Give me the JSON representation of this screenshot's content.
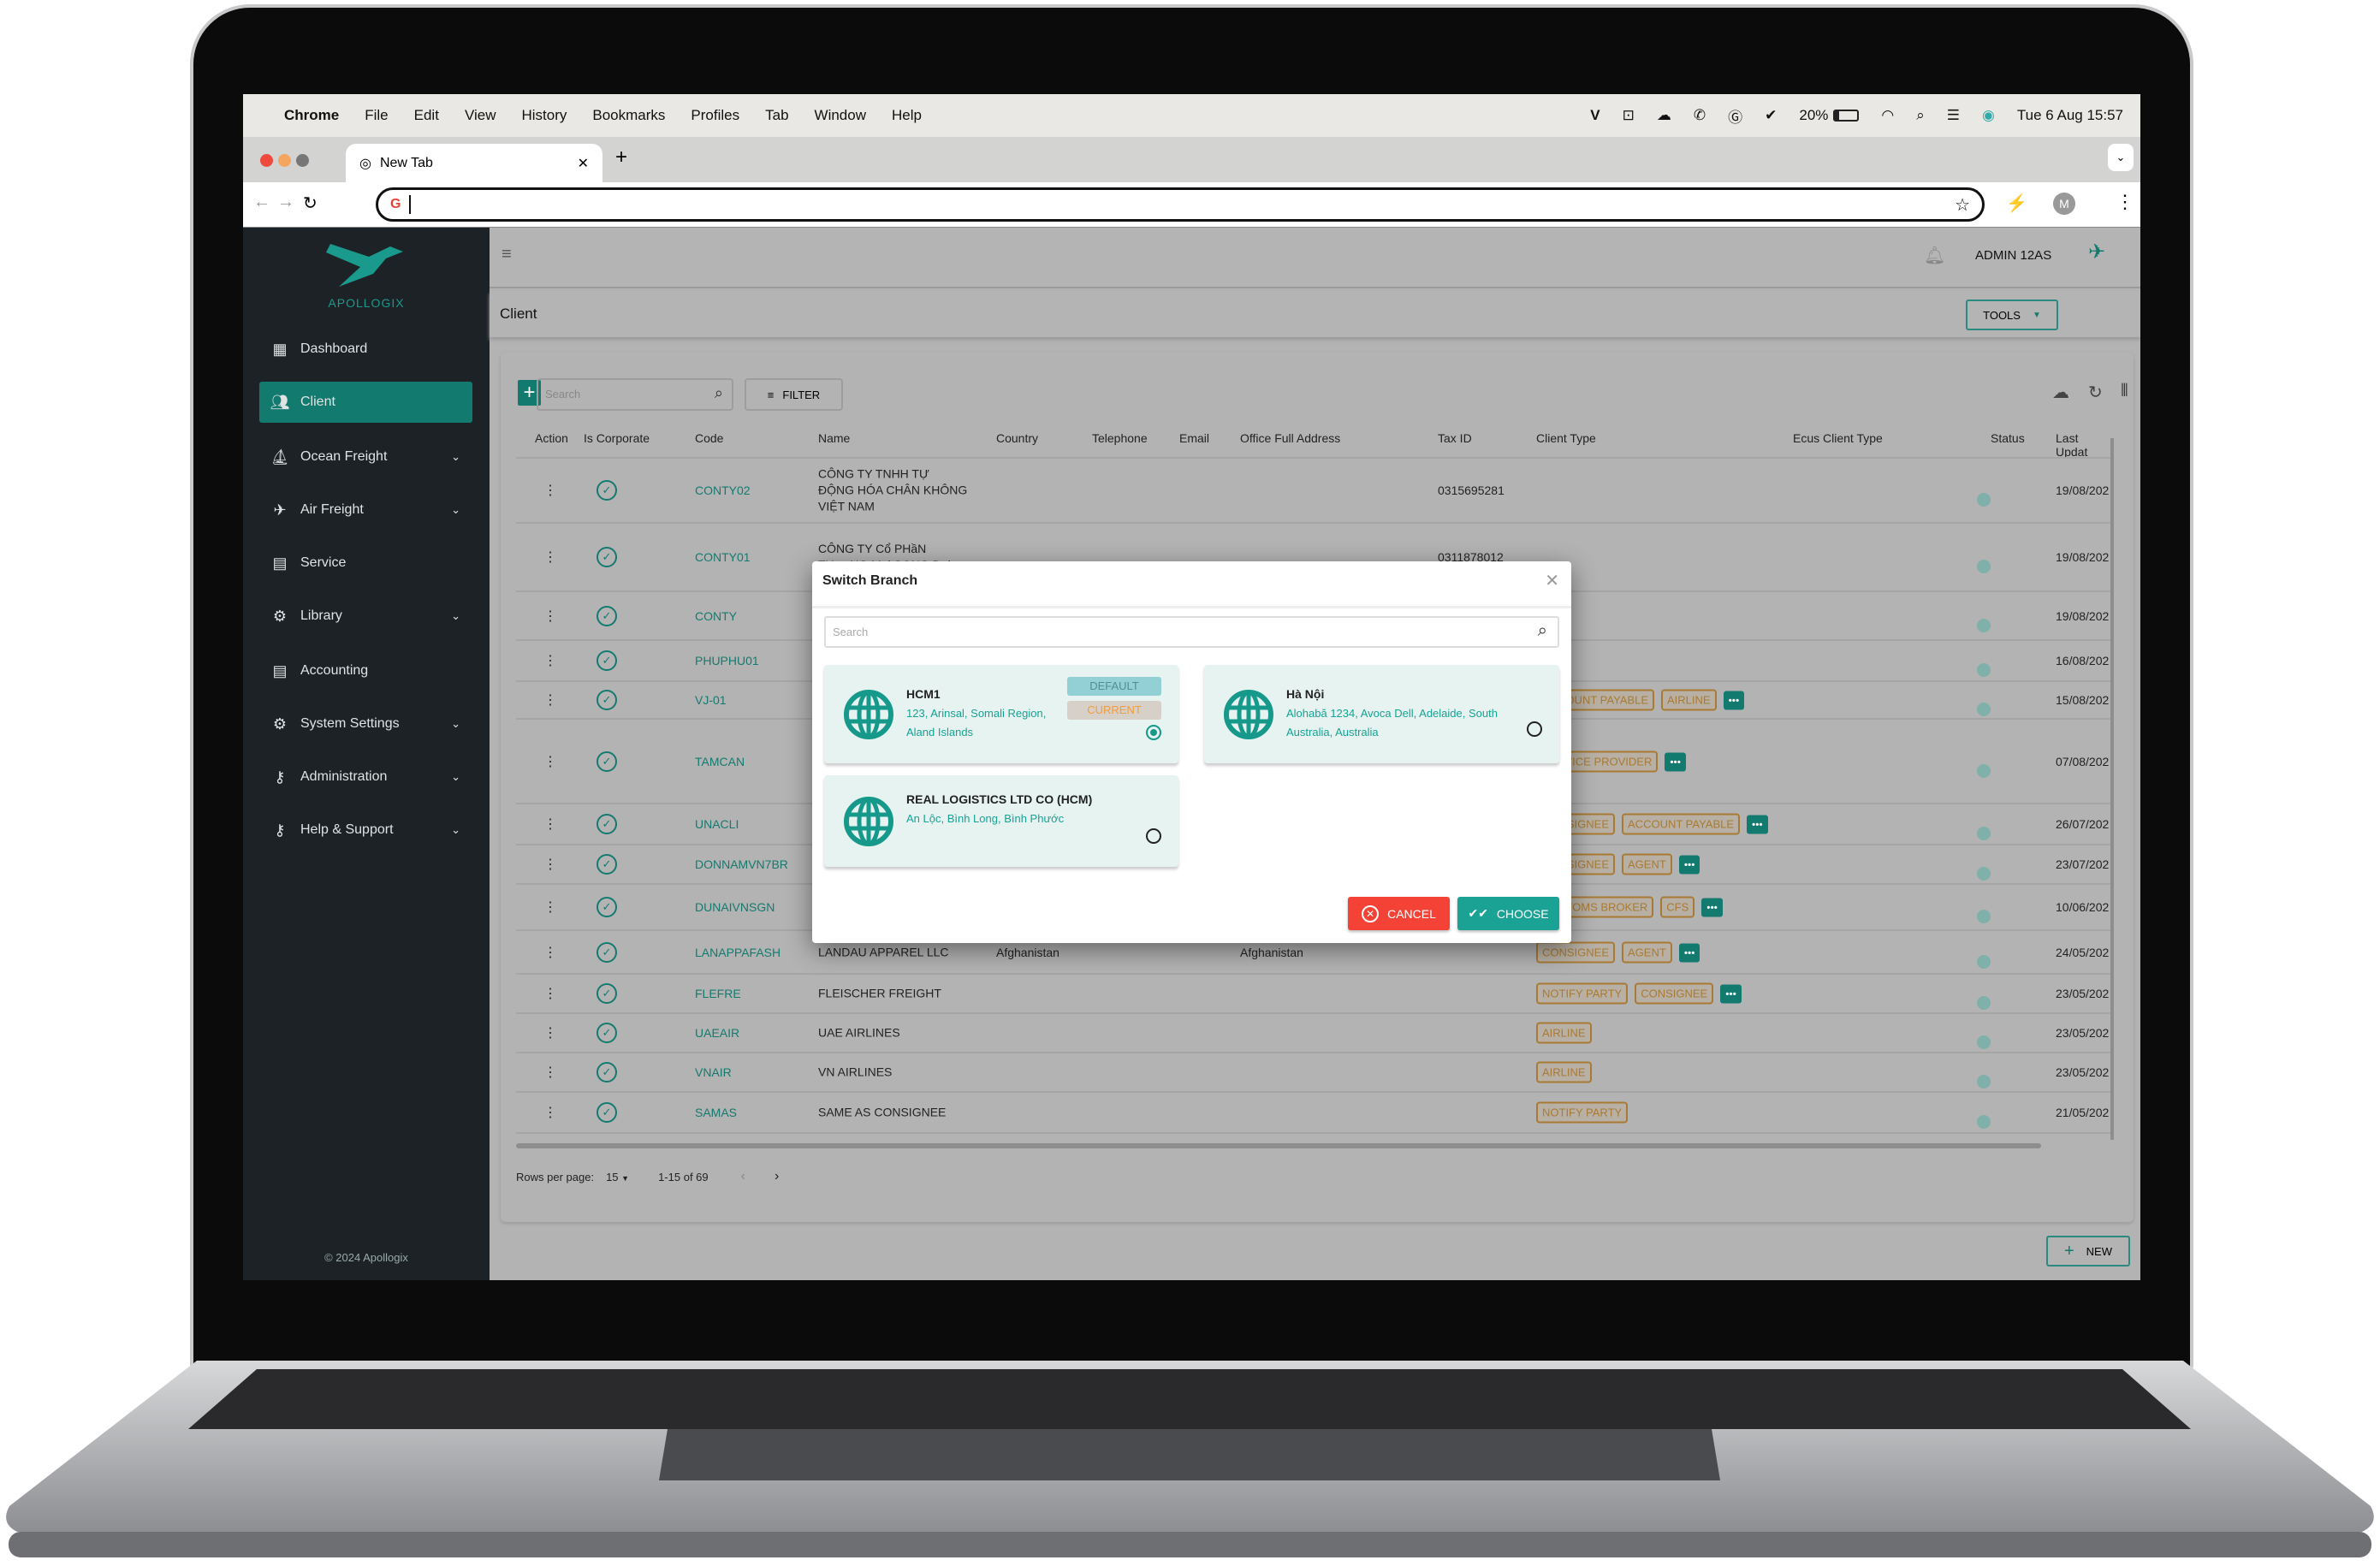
{
  "menubar": {
    "app": "Chrome",
    "items": [
      "File",
      "Edit",
      "View",
      "History",
      "Bookmarks",
      "Profiles",
      "Tab",
      "Window",
      "Help"
    ],
    "battery": "20%",
    "datetime": "Tue 6 Aug  15:57",
    "status_icons": [
      "vpn-v-icon",
      "teamviewer-icon",
      "cloud-sync-icon",
      "phone-chat-icon",
      "grammarly-icon",
      "shield-check-icon",
      "battery-icon",
      "wifi-icon",
      "spotlight-search-icon",
      "control-center-icon",
      "siri-icon"
    ]
  },
  "browser": {
    "tab_title": "New Tab",
    "address": "",
    "profile_initial": "M"
  },
  "sidebar": {
    "brand": "APOLLOGIX",
    "items": [
      {
        "label": "Dashboard",
        "icon": "dashboard-icon",
        "expandable": false,
        "active": false
      },
      {
        "label": "Client",
        "icon": "people-icon",
        "expandable": false,
        "active": true
      },
      {
        "label": "Ocean Freight",
        "icon": "ship-icon",
        "expandable": true,
        "active": false
      },
      {
        "label": "Air Freight",
        "icon": "plane-icon",
        "expandable": true,
        "active": false
      },
      {
        "label": "Service",
        "icon": "list-icon",
        "expandable": false,
        "active": false
      },
      {
        "label": "Library",
        "icon": "gears-icon",
        "expandable": true,
        "active": false
      },
      {
        "label": "Accounting",
        "icon": "list-icon",
        "expandable": false,
        "active": false
      },
      {
        "label": "System Settings",
        "icon": "gear-icon",
        "expandable": true,
        "active": false
      },
      {
        "label": "Administration",
        "icon": "key-icon",
        "expandable": true,
        "active": false
      },
      {
        "label": "Help & Support",
        "icon": "key-icon",
        "expandable": true,
        "active": false
      }
    ],
    "footer": "© 2024 Apollogix"
  },
  "header": {
    "user": "ADMIN 12AS"
  },
  "page": {
    "title": "Client",
    "tools_label": "TOOLS"
  },
  "toolbar": {
    "search_placeholder": "Search",
    "filter_label": "FILTER"
  },
  "table": {
    "columns": [
      "Action",
      "Is Corporate",
      "Code",
      "Name",
      "Country",
      "Telephone",
      "Email",
      "Office Full Address",
      "Tax ID",
      "Client Type",
      "Ecus Client Type",
      "Status",
      "Last Updat"
    ],
    "rows": [
      {
        "code": "CONTY02",
        "name": "CÔNG TY TNHH TỰ ĐỘNG HÓA CHÂN KHÔNG VIỆT NAM",
        "country": "",
        "office": "",
        "tax_id": "0315695281",
        "client_types": [],
        "more": false,
        "status": true,
        "updated": "19/08/202"
      },
      {
        "code": "CONTY01",
        "name": "CÔNG TY Cổ PHầN THươNG Mại SONG Đại",
        "country": "",
        "office": "",
        "tax_id": "0311878012",
        "client_types": [],
        "more": false,
        "status": true,
        "updated": "19/08/202"
      },
      {
        "code": "CONTY",
        "name": "",
        "country": "",
        "office": "",
        "tax_id": "",
        "client_types": [],
        "more": false,
        "status": true,
        "updated": "19/08/202"
      },
      {
        "code": "PHUPHU01",
        "name": "",
        "country": "",
        "office": "",
        "tax_id": "",
        "client_types": [],
        "more": false,
        "status": true,
        "updated": "16/08/202"
      },
      {
        "code": "VJ-01",
        "name": "",
        "country": "",
        "office": "",
        "tax_id": "",
        "client_types": [
          "ACCOUNT PAYABLE",
          "AIRLINE"
        ],
        "more": true,
        "status": true,
        "updated": "15/08/202"
      },
      {
        "code": "TAMCAN",
        "name": "",
        "country": "",
        "office": "",
        "tax_id": "",
        "client_types": [
          "SERVICE PROVIDER"
        ],
        "more": true,
        "status": true,
        "updated": "07/08/202"
      },
      {
        "code": "UNACLI",
        "name": "",
        "country": "",
        "office": "",
        "tax_id": "",
        "client_types": [
          "CONSIGNEE",
          "ACCOUNT PAYABLE"
        ],
        "more": true,
        "status": true,
        "updated": "26/07/202"
      },
      {
        "code": "DONNAMVN7BR",
        "name": "",
        "country": "",
        "office": "",
        "tax_id": "",
        "client_types": [
          "CONSIGNEE",
          "AGENT"
        ],
        "more": true,
        "status": true,
        "updated": "23/07/202"
      },
      {
        "code": "DUNAIVNSGN",
        "name": "",
        "country": "",
        "office": "",
        "tax_id": "",
        "client_types": [
          "CUSTOMS BROKER",
          "CFS"
        ],
        "more": true,
        "status": true,
        "updated": "10/06/202"
      },
      {
        "code": "LANAPPAFASH",
        "name": "LANDAU APPAREL LLC",
        "country": "Afghanistan",
        "office": "Afghanistan",
        "tax_id": "",
        "client_types": [
          "CONSIGNEE",
          "AGENT"
        ],
        "more": true,
        "status": true,
        "updated": "24/05/202"
      },
      {
        "code": "FLEFRE",
        "name": "FLEISCHER FREIGHT",
        "country": "",
        "office": "",
        "tax_id": "",
        "client_types": [
          "NOTIFY PARTY",
          "CONSIGNEE"
        ],
        "more": true,
        "status": true,
        "updated": "23/05/202"
      },
      {
        "code": "UAEAIR",
        "name": "UAE AIRLINES",
        "country": "",
        "office": "",
        "tax_id": "",
        "client_types": [
          "AIRLINE"
        ],
        "more": false,
        "status": true,
        "updated": "23/05/202"
      },
      {
        "code": "VNAIR",
        "name": "VN AIRLINES",
        "country": "",
        "office": "",
        "tax_id": "",
        "client_types": [
          "AIRLINE"
        ],
        "more": false,
        "status": true,
        "updated": "23/05/202"
      },
      {
        "code": "SAMAS",
        "name": "SAME AS CONSIGNEE",
        "country": "",
        "office": "",
        "tax_id": "",
        "client_types": [
          "NOTIFY PARTY"
        ],
        "more": false,
        "status": true,
        "updated": "21/05/202"
      }
    ]
  },
  "pagination": {
    "rows_per_page_label": "Rows per page:",
    "rows_per_page": "15",
    "range": "1-15 of 69"
  },
  "new_button": "NEW",
  "modal": {
    "title": "Switch Branch",
    "search_placeholder": "Search",
    "cancel_label": "CANCEL",
    "choose_label": "CHOOSE",
    "branches": [
      {
        "name": "HCM1",
        "address": "123, Arinsal, Somali Region, Aland Islands",
        "badges": [
          "DEFAULT",
          "CURRENT"
        ],
        "selected": true
      },
      {
        "name": "Hà Nội",
        "address": "Alohabă 1234, Avoca Dell, Adelaide, South Australia, Australia",
        "badges": [],
        "selected": false
      },
      {
        "name": "REAL LOGISTICS LTD CO (HCM)",
        "address": "An Lộc, Bình Long, Bình Phước",
        "badges": [],
        "selected": false
      }
    ]
  },
  "colors": {
    "brand": "#137a70",
    "sidebar": "#1c2226",
    "cancel": "#f44336",
    "choose": "#1aa394",
    "tag": "#a97a33",
    "default_badge": "#93d0d5",
    "current_badge": "#f39c3c"
  }
}
